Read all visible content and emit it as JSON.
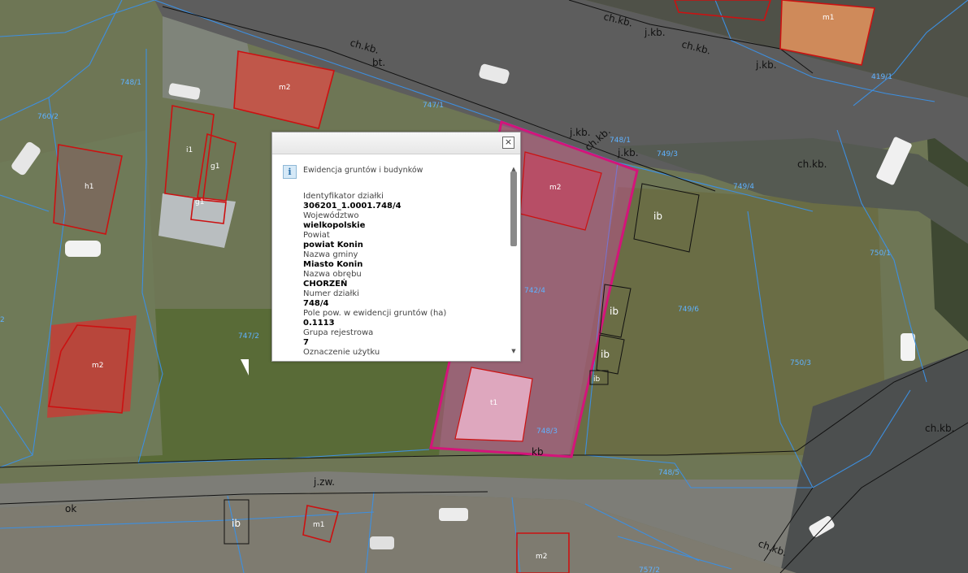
{
  "map": {
    "parcels": {
      "p748_1_top": "748/1",
      "p747_1": "747/1",
      "p748_1_road": "748/1",
      "p749_3": "749/3",
      "p749_4": "749/4",
      "p742_4": "742/4",
      "p749_6": "749/6",
      "p750_3": "750/3",
      "p750_1": "750/1",
      "p747_2": "747/2",
      "p748_3": "748/3",
      "p748_5": "748/5",
      "p760_2": "760/2",
      "p419_1": "419/1",
      "p757_2": "757/2",
      "p760_2_edge": "2"
    },
    "buildings": {
      "m1_tr": "m1",
      "m2_top": "m2",
      "h1": "h1",
      "i1": "i1",
      "g1a": "g1",
      "g1b": "g1",
      "m2_sel": "m2",
      "m2_left": "m2",
      "ib1": "ib",
      "ib2": "ib",
      "ib3": "ib",
      "ib4": "ib",
      "ib5": "ib",
      "t1": "t1",
      "m1_bot": "m1",
      "m2_bot": "m2"
    },
    "road_labels": {
      "chkb1": "ch.kb.",
      "jkb1": "j.kb.",
      "chkb2": "ch.kb.",
      "jkb2": "j.kb.",
      "chkb3": "ch.kb.",
      "bt": "bt.",
      "jkb3": "j.kb.",
      "chkb4": "ch.kb.",
      "jkb4": "j.kb.",
      "chkb5": "ch.kb.",
      "kb": "kb",
      "jzw": "j.zw.",
      "ok": "ok",
      "chkb6": "ch.kb.",
      "chkb7": "ch.kb."
    }
  },
  "popup": {
    "layer_title": "Ewidencja gruntów i budynków",
    "close_label": "×",
    "fields": [
      {
        "label": "Identyfikator działki",
        "value": "306201_1.0001.748/4"
      },
      {
        "label": "Województwo",
        "value": "wielkopolskie"
      },
      {
        "label": "Powiat",
        "value": "powiat Konin"
      },
      {
        "label": "Nazwa gminy",
        "value": "Miasto Konin"
      },
      {
        "label": "Nazwa obrębu",
        "value": "CHORZEŃ"
      },
      {
        "label": "Numer działki",
        "value": "748/4"
      },
      {
        "label": "Pole pow. w ewidencji gruntów (ha)",
        "value": "0.1113"
      },
      {
        "label": "Grupa rejestrowa",
        "value": "7"
      },
      {
        "label": "Oznaczenie użytku",
        "value": ""
      }
    ]
  },
  "colors": {
    "parcel_line": "#3d8fe0",
    "building_line": "#cc1111",
    "selected_parcel": "#d4147a",
    "road": "#5e5e5e",
    "vegetation": "#5b6a3a"
  }
}
